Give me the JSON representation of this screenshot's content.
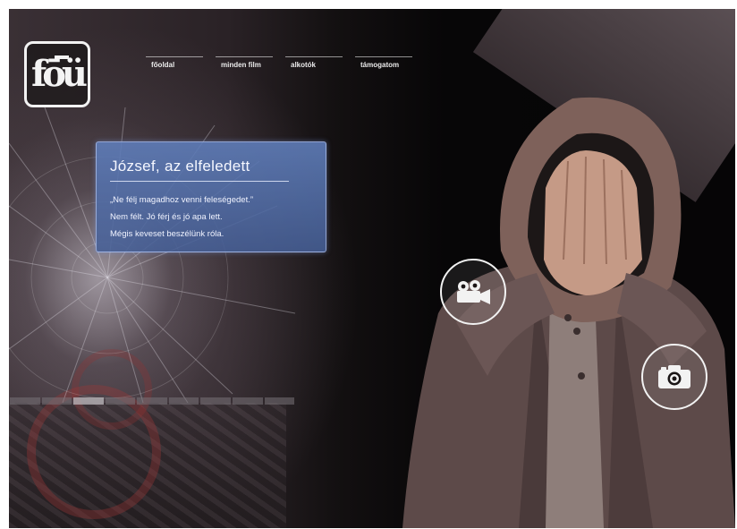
{
  "logo": {
    "text": "fōü"
  },
  "nav": {
    "items": [
      {
        "label": "főoldal"
      },
      {
        "label": "minden film"
      },
      {
        "label": "alkotók"
      },
      {
        "label": "támogatom"
      }
    ]
  },
  "panel": {
    "title": "József, az elfeledett",
    "lines": [
      "„Ne félj magadhoz venni feleségedet.”",
      "Nem félt. Jó férj és jó apa lett.",
      "Mégis keveset beszélünk róla."
    ]
  },
  "progress": {
    "segments": 9,
    "active_index": 2
  },
  "icons": {
    "video": "video-camera-icon",
    "photo": "photo-camera-icon"
  },
  "colors": {
    "panel": "#5f7db9",
    "background": "#070607",
    "accent_white": "#f2f2f2"
  }
}
